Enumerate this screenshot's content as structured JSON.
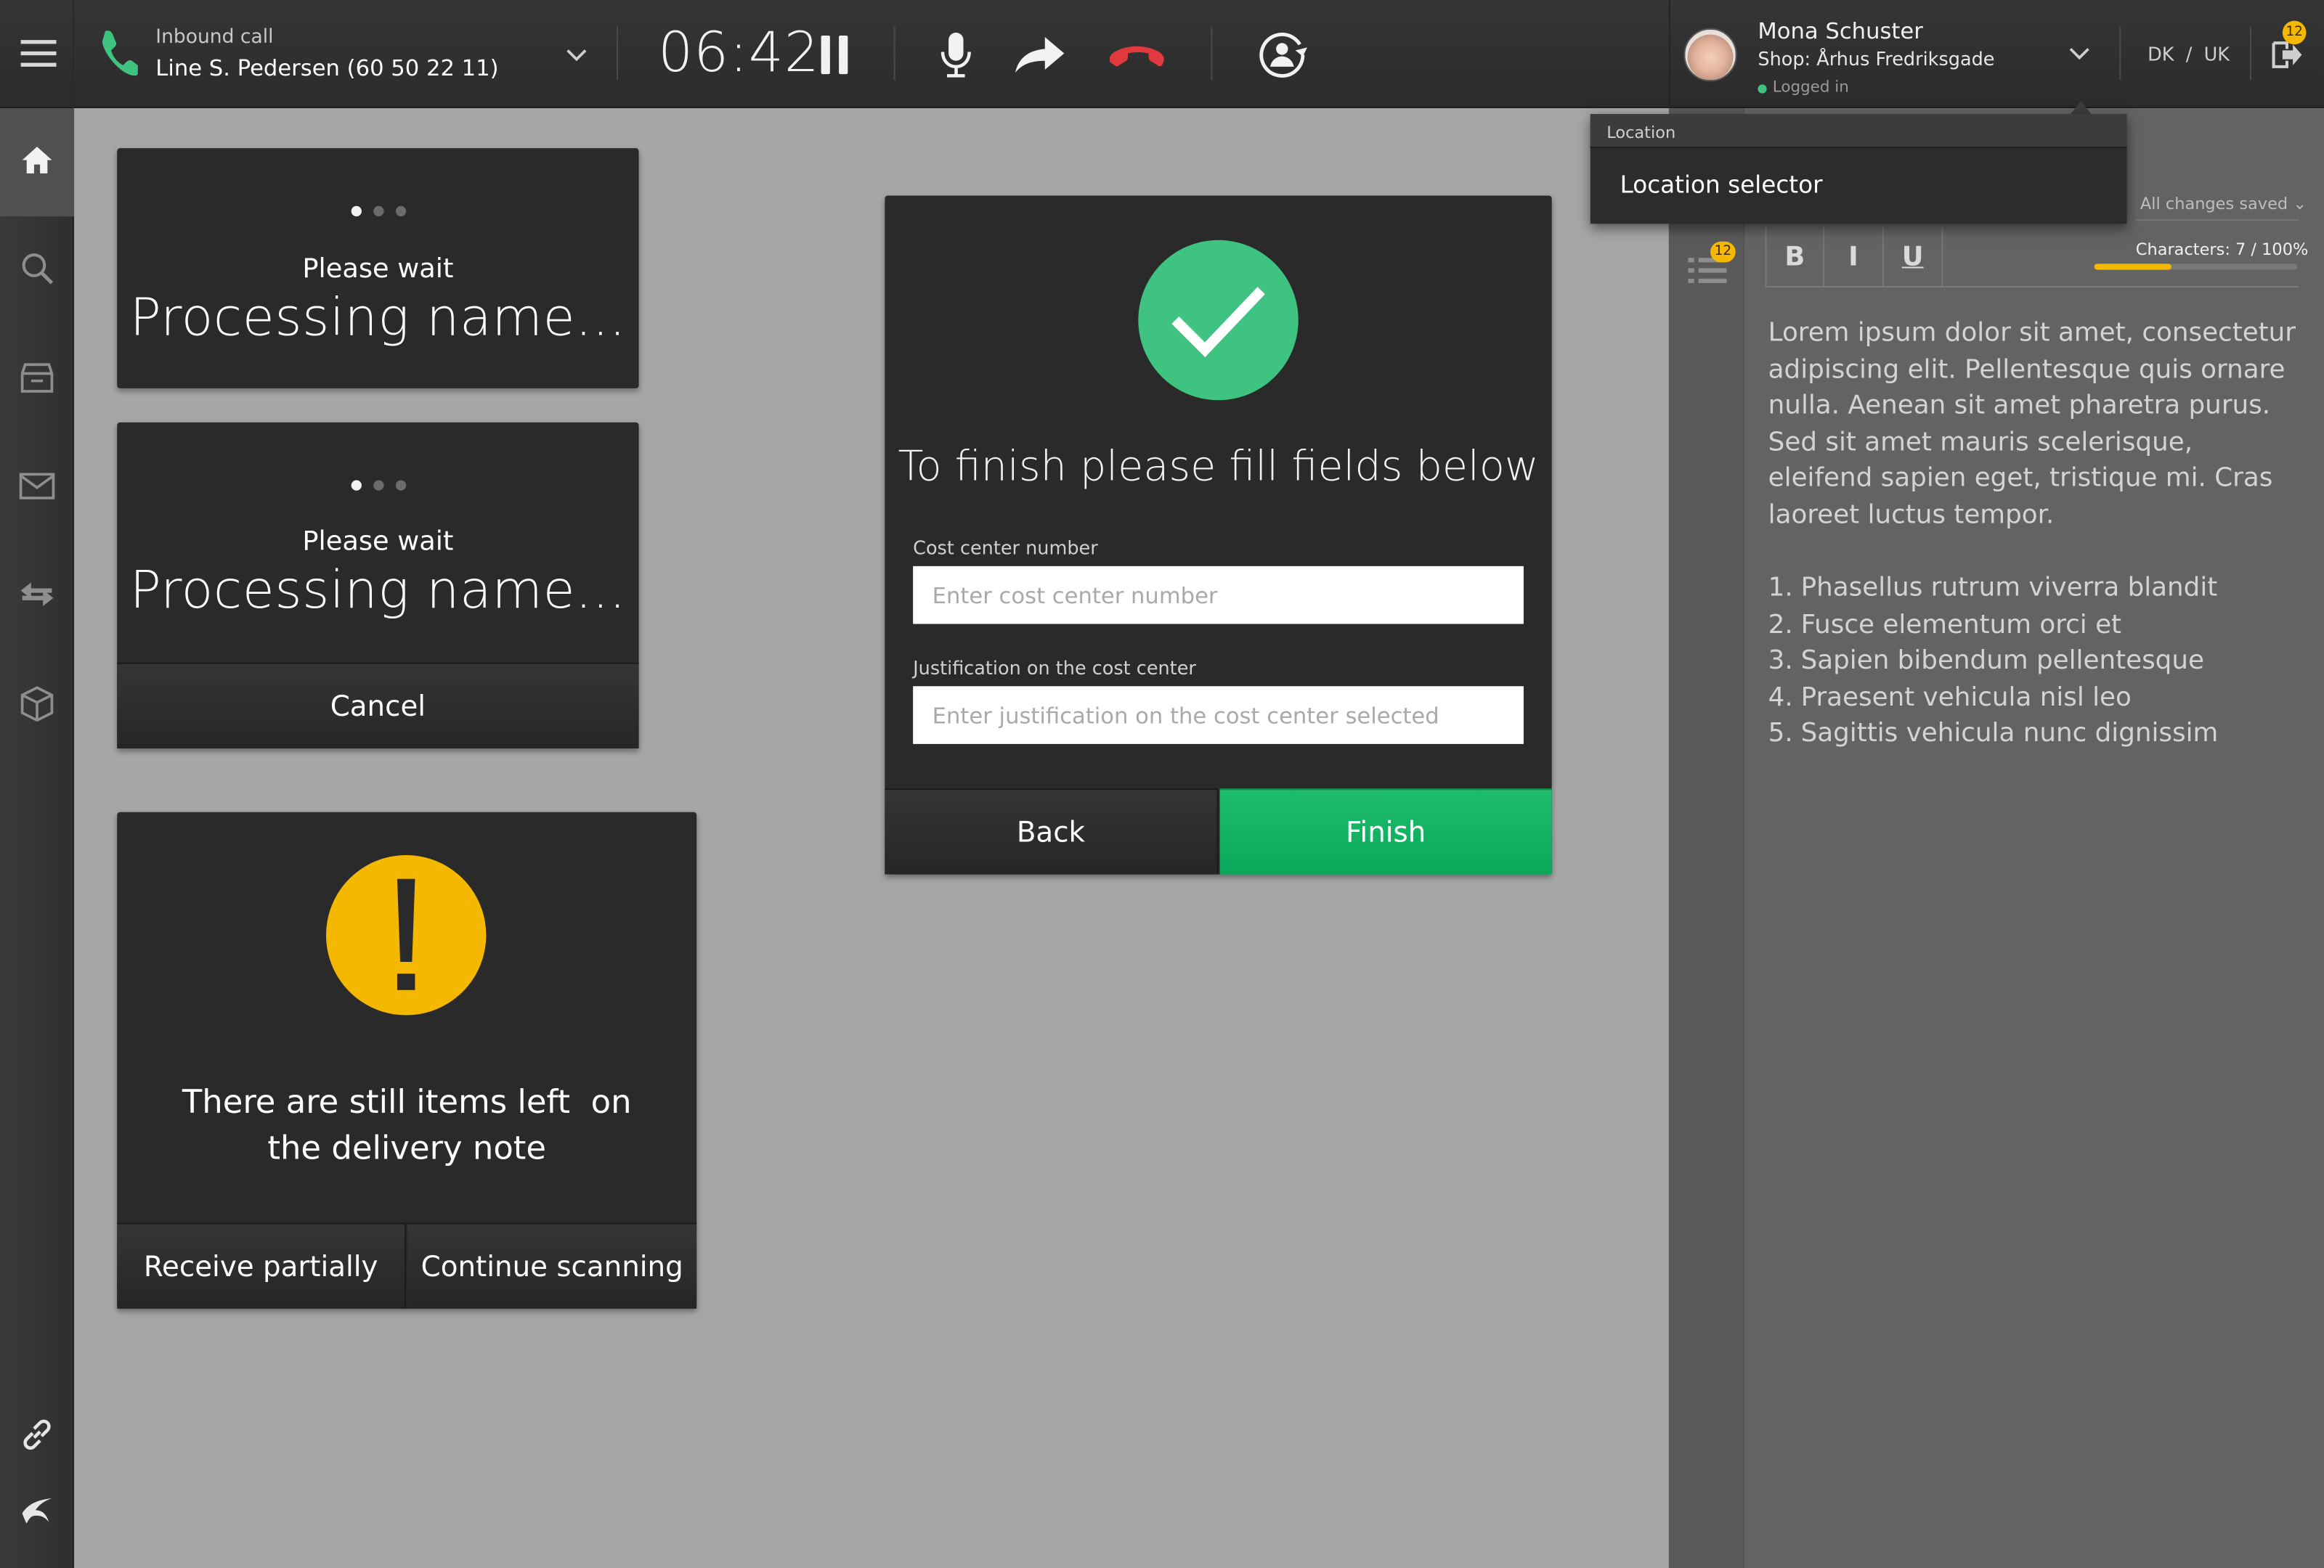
{
  "topbar": {
    "call_label": "Inbound call",
    "caller": "Line S. Pedersen (60 50 22 11)",
    "timer": "06:42",
    "user_name": "Mona Schuster",
    "user_shop": "Shop: Århus Fredriksgade",
    "user_status": "Logged in",
    "languages": "DK / UK",
    "notification_count": "12"
  },
  "location_dropdown": {
    "header": "Location",
    "item": "Location selector"
  },
  "processing_card_1": {
    "wait": "Please wait",
    "status": "Processing name..."
  },
  "processing_card_2": {
    "wait": "Please wait",
    "status": "Processing name...",
    "cancel": "Cancel"
  },
  "warning_card": {
    "message_line1": "There are still items left  on",
    "message_line2": "the delivery note",
    "receive_partially": "Receive partially",
    "continue_scanning": "Continue scanning"
  },
  "finish_dialog": {
    "title": "To finish please fill fields below",
    "cost_center_label": "Cost center number",
    "cost_center_placeholder": "Enter cost center number",
    "justification_label": "Justification on the cost center",
    "justification_placeholder": "Enter justification on the cost center selected",
    "back": "Back",
    "finish": "Finish"
  },
  "editor": {
    "saved_status": "All changes saved",
    "bold": "B",
    "italic": "I",
    "underline": "U",
    "characters": "Characters: 7 / 100%",
    "char_progress": 0.38,
    "list_badge": "12",
    "paragraph": "Lorem ipsum dolor sit amet, consectetur adipiscing elit. Pellentesque quis ornare nulla. Aenean sit amet pharetra purus. Sed sit amet mauris scelerisque, eleifend sapien eget, tristique mi. Cras laoreet luctus tempor.",
    "list": [
      {
        "n": "1.",
        "text": "Phasellus rutrum viverra blandit"
      },
      {
        "n": "2.",
        "text": "Fusce elementum orci et"
      },
      {
        "n": "3.",
        "text": "Sapien bibendum pellentesque"
      },
      {
        "n": "4.",
        "text": "Praesent vehicula nisl leo"
      },
      {
        "n": "5.",
        "text": "Sagittis vehicula nunc dignissim"
      }
    ]
  },
  "colors": {
    "success": "#3fc380",
    "finish_button": "#10b060",
    "warning": "#f5b800",
    "hangup": "#e0393e",
    "phone": "#3fc380"
  },
  "icons": {
    "menu": "hamburger-icon",
    "phone": "phone-icon",
    "pause": "pause-icon",
    "mic": "microphone-icon",
    "forward": "forward-arrow-icon",
    "hangup": "hang-up-icon",
    "transfer": "user-transfer-icon"
  }
}
